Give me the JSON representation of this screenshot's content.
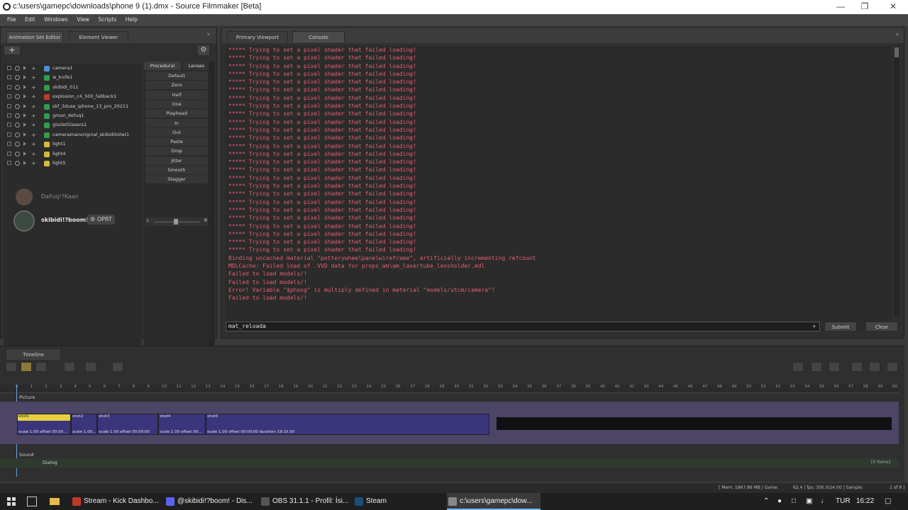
{
  "window": {
    "title": "c:\\users\\gamepc\\downloads\\phone 9 (1).dmx - Source Filmmaker [Beta]"
  },
  "menu": [
    "File",
    "Edit",
    "Windows",
    "View",
    "Scripts",
    "Help"
  ],
  "left_tabs": [
    "Animation Set Editor",
    "Element Viewer"
  ],
  "tree_items": [
    {
      "label": "camera1",
      "color": "#4a90d9"
    },
    {
      "label": "w_knife1",
      "color": "#2e9e4a"
    },
    {
      "label": "skibidi_011",
      "color": "#2e9e4a"
    },
    {
      "label": "explosion_c4_500_fallback1",
      "color": "#c0392b"
    },
    {
      "label": "skf_3duse_iphone_13_pro_20211",
      "color": "#2e9e4a"
    },
    {
      "label": "gman_defuq1",
      "color": "#2e9e4a"
    },
    {
      "label": "gtoilet5lasers1",
      "color": "#2e9e4a"
    },
    {
      "label": "cameramanoriginal_skibiditoilet1",
      "color": "#2e9e4a"
    },
    {
      "label": "light1",
      "color": "#d4b93a"
    },
    {
      "label": "light4",
      "color": "#d4b93a"
    },
    {
      "label": "light5",
      "color": "#d4b93a"
    }
  ],
  "proc_tabs": [
    "Procedural",
    "Lenses"
  ],
  "proc_buttons": [
    "Default",
    "Zero",
    "Half",
    "One",
    "Playhead",
    "In",
    "Out",
    "Paste",
    "Drop",
    "Jitter",
    "Smooth",
    "Stagger"
  ],
  "slider": {
    "left": "L",
    "right": "R"
  },
  "users": [
    {
      "name": "DaFuq!?Kaan"
    },
    {
      "name": "skibidi!?boom!",
      "badge": "OPRT"
    }
  ],
  "right_tabs": [
    "Primary Viewport",
    "Console"
  ],
  "console": {
    "shader_line": "***** Trying to set a pixel shader that failed loading!",
    "shader_count": 26,
    "tail": [
      "Binding uncached material \"potterywheelpanelwireframe\", artificially incrementing refcount",
      "MDLCache: Failed load of .VVD data for props_am\\am_lasertube_lensholder.mdl",
      "Failed to load models/!",
      "Failed to load models/!",
      "Error! Variable \"$phong\" is multiply defined in material \"models/utcm/camera\"!",
      "Failed to load models/!"
    ],
    "input_value": "mat_reloada",
    "submit": "Submit",
    "clear": "Clear"
  },
  "timeline": {
    "tab": "Timeline",
    "ticks": [
      "0",
      "1",
      "2",
      "3",
      "4",
      "5",
      "6",
      "7",
      "8",
      "9",
      "10",
      "11",
      "12",
      "13",
      "14",
      "15",
      "16",
      "17",
      "18",
      "19",
      "20",
      "21",
      "22",
      "23",
      "24",
      "25",
      "26",
      "27",
      "28",
      "29",
      "30",
      "31",
      "32",
      "33",
      "34",
      "35",
      "36",
      "37",
      "38",
      "39",
      "40",
      "41",
      "42",
      "43",
      "44",
      "45",
      "46",
      "47",
      "48",
      "49",
      "50",
      "51",
      "52",
      "53",
      "54",
      "55",
      "56",
      "57",
      "58",
      "59",
      "60"
    ],
    "picture": "Picture",
    "sound": "Sound",
    "dialog": "Dialog",
    "items": "[0 items]",
    "shots": [
      {
        "name": "shot1",
        "info": "scale 1.00 offset  00:00..."
      },
      {
        "name": "shot2",
        "info": "scale 1.00..."
      },
      {
        "name": "shot3",
        "info": "scale 1.00 offset  00:00:00"
      },
      {
        "name": "shot4",
        "info": "scale 1.00 offset  00..."
      },
      {
        "name": "shot5",
        "info": "scale 1.00 offset  00:00:00 duration  19:10.00"
      }
    ]
  },
  "status": {
    "mem": "[ Mem: 1867.86 MB | Game:",
    "fps": "62.4 | fps: 300.0/24.00 | Sample:",
    "sample": "1 of 8 ]"
  },
  "taskbar": {
    "apps": [
      {
        "label": "Stream - Kick Dashbo...",
        "color": "#c0392b"
      },
      {
        "label": "@skibidi!?boom! - Dis...",
        "color": "#5865f2"
      },
      {
        "label": "OBS 31.1.1 - Profil: İsi...",
        "color": "#555555"
      },
      {
        "label": "Steam",
        "color": "#1b4e7a"
      },
      {
        "label": "c:\\users\\gamepc\\dow...",
        "color": "#888888"
      }
    ],
    "lang": "TUR",
    "time": "16:22"
  }
}
